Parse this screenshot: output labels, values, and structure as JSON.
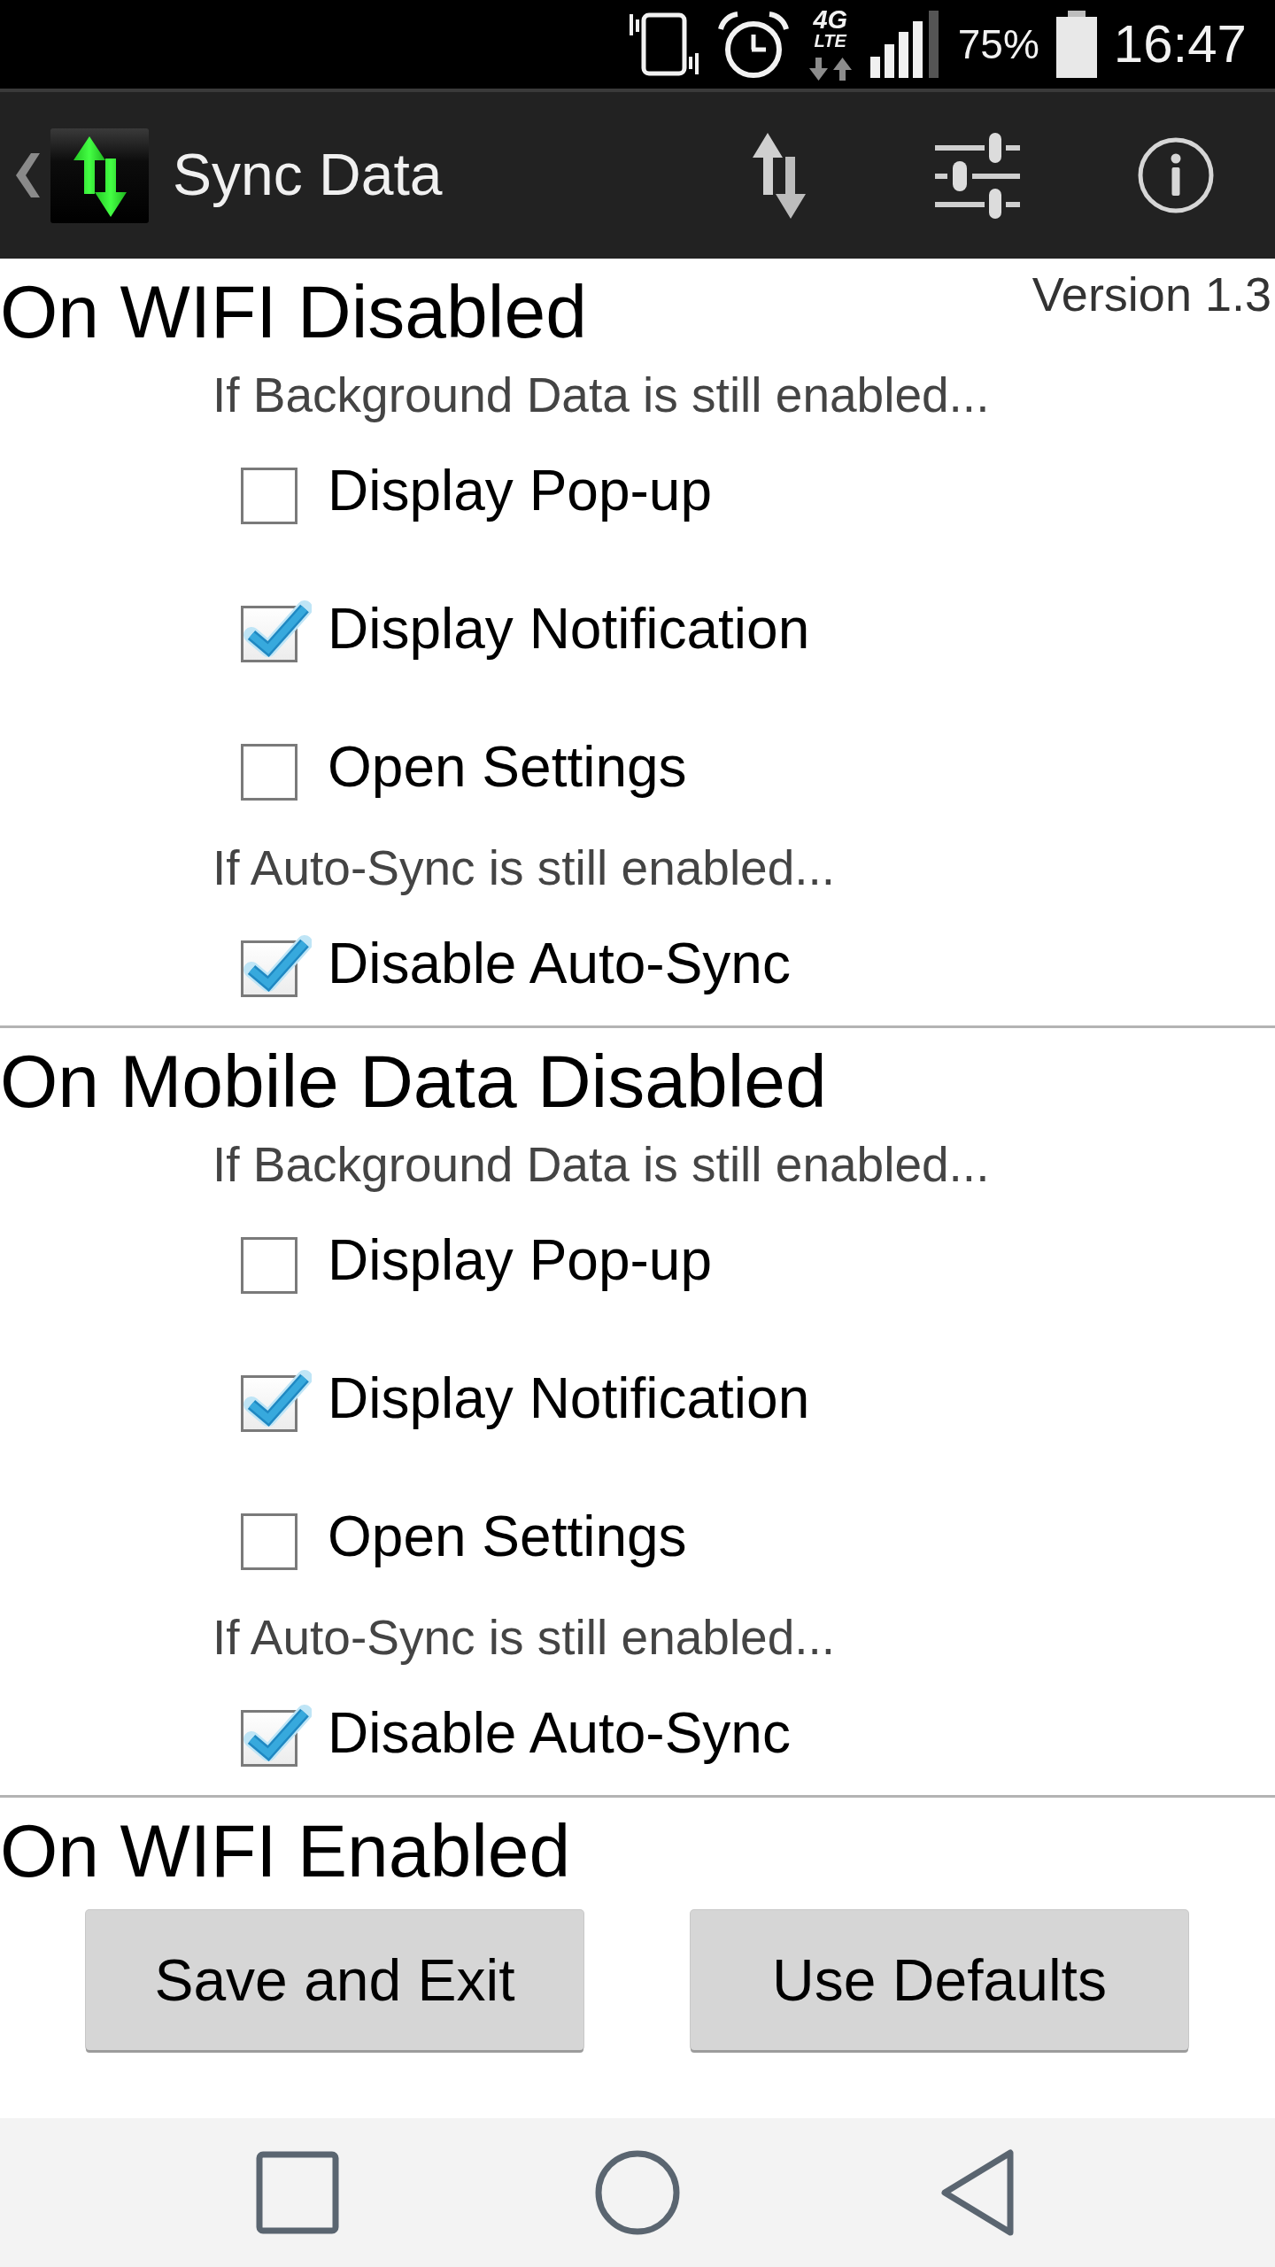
{
  "status_bar": {
    "network_type": "4G",
    "network_label": "LTE",
    "battery": "75%",
    "time": "16:47"
  },
  "app_bar": {
    "title": "Sync Data"
  },
  "sections": [
    {
      "title": "On WIFI Disabled",
      "version": "Version 1.3",
      "groups": [
        {
          "caption": "If Background Data is still enabled...",
          "options": [
            {
              "label": "Display Pop-up",
              "checked": false
            },
            {
              "label": "Display Notification",
              "checked": true
            },
            {
              "label": "Open Settings",
              "checked": false
            }
          ]
        },
        {
          "caption": "If Auto-Sync is still enabled...",
          "options": [
            {
              "label": "Disable Auto-Sync",
              "checked": true
            }
          ]
        }
      ]
    },
    {
      "title": "On Mobile Data Disabled",
      "groups": [
        {
          "caption": "If Background Data is still enabled...",
          "options": [
            {
              "label": "Display Pop-up",
              "checked": false
            },
            {
              "label": "Display Notification",
              "checked": true
            },
            {
              "label": "Open Settings",
              "checked": false
            }
          ]
        },
        {
          "caption": "If Auto-Sync is still enabled...",
          "options": [
            {
              "label": "Disable Auto-Sync",
              "checked": true
            }
          ]
        }
      ]
    },
    {
      "title": "On WIFI Enabled"
    }
  ],
  "buttons": [
    "Save and Exit",
    "Use Defaults"
  ]
}
